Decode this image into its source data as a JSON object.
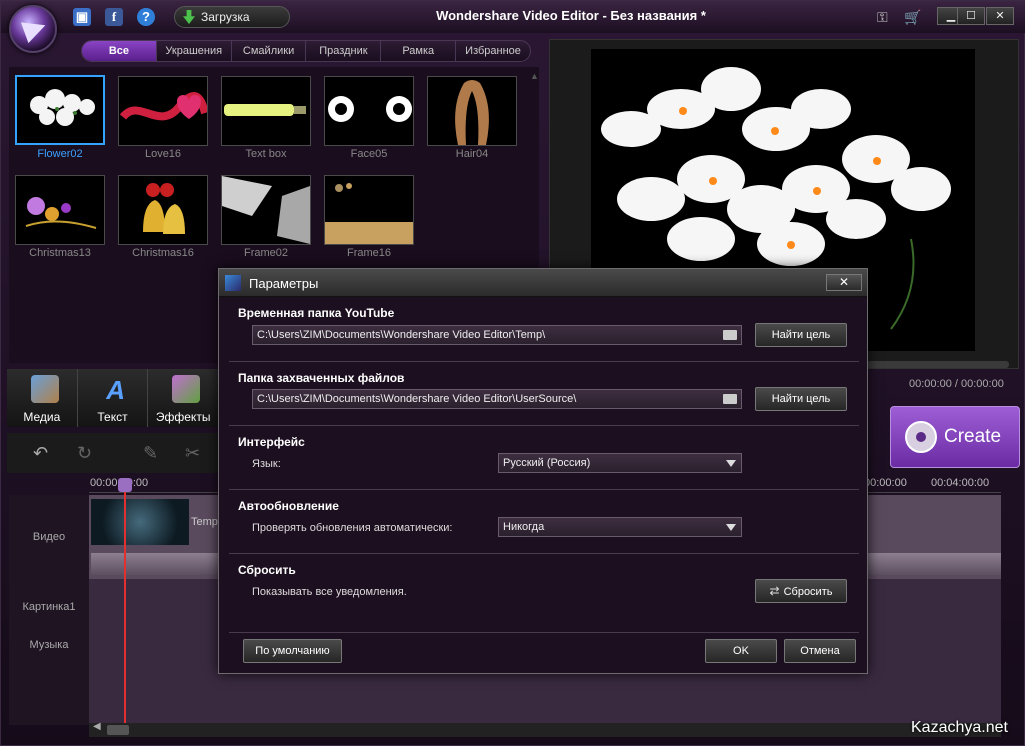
{
  "app": {
    "title": "Wondershare Video Editor - Без названия *",
    "download_label": "Загрузка",
    "save_icon": "save-icon",
    "facebook_icon": "f",
    "help_icon": "?",
    "min_label": "▁",
    "max_label": "☐",
    "close_label": "✕"
  },
  "categories": {
    "tabs": [
      {
        "label": "Все",
        "active": true
      },
      {
        "label": "Украшения"
      },
      {
        "label": "Смайлики"
      },
      {
        "label": "Праздник"
      },
      {
        "label": "Рамка"
      },
      {
        "label": "Избранное"
      }
    ]
  },
  "library": {
    "items": [
      {
        "label": "Flower02",
        "selected": true
      },
      {
        "label": "Love16"
      },
      {
        "label": "Text box"
      },
      {
        "label": "Face05"
      },
      {
        "label": "Hair04"
      },
      {
        "label": "Christmas13"
      },
      {
        "label": "Christmas16"
      },
      {
        "label": "Frame02"
      },
      {
        "label": "Frame16"
      }
    ]
  },
  "preview": {
    "timecode": "00:00:00 / 00:00:00",
    "create_label": "Create"
  },
  "tools": {
    "tabs": [
      {
        "label": "Медиа"
      },
      {
        "label": "Текст"
      },
      {
        "label": "Эффекты"
      }
    ]
  },
  "timeline": {
    "ruler": [
      "00:00:00:00",
      "00:00:00",
      "00:04:00:00"
    ],
    "tracks": [
      "Видео",
      "Картинка1",
      "Музыка"
    ],
    "clip_label": "Temp"
  },
  "watermark": "Kazachya.net",
  "dialog": {
    "title": "Параметры",
    "close_label": "✕",
    "youtube": {
      "title": "Временная папка YouTube",
      "path": "C:\\Users\\ZIM\\Documents\\Wondershare Video Editor\\Temp\\",
      "button": "Найти цель"
    },
    "capture": {
      "title": "Папка захваченных файлов",
      "path": "C:\\Users\\ZIM\\Documents\\Wondershare Video Editor\\UserSource\\",
      "button": "Найти цель"
    },
    "interface": {
      "title": "Интерфейс",
      "language_label": "Язык:",
      "language_value": "Русский (Россия)"
    },
    "autoupdate": {
      "title": "Автообновление",
      "label": "Проверять обновления автоматически:",
      "value": "Никогда"
    },
    "reset": {
      "title": "Сбросить",
      "label": "Показывать все уведомления.",
      "button": "Сбросить"
    },
    "footer": {
      "default_button": "По умолчанию",
      "ok_button": "OK",
      "cancel_button": "Отмена"
    }
  }
}
